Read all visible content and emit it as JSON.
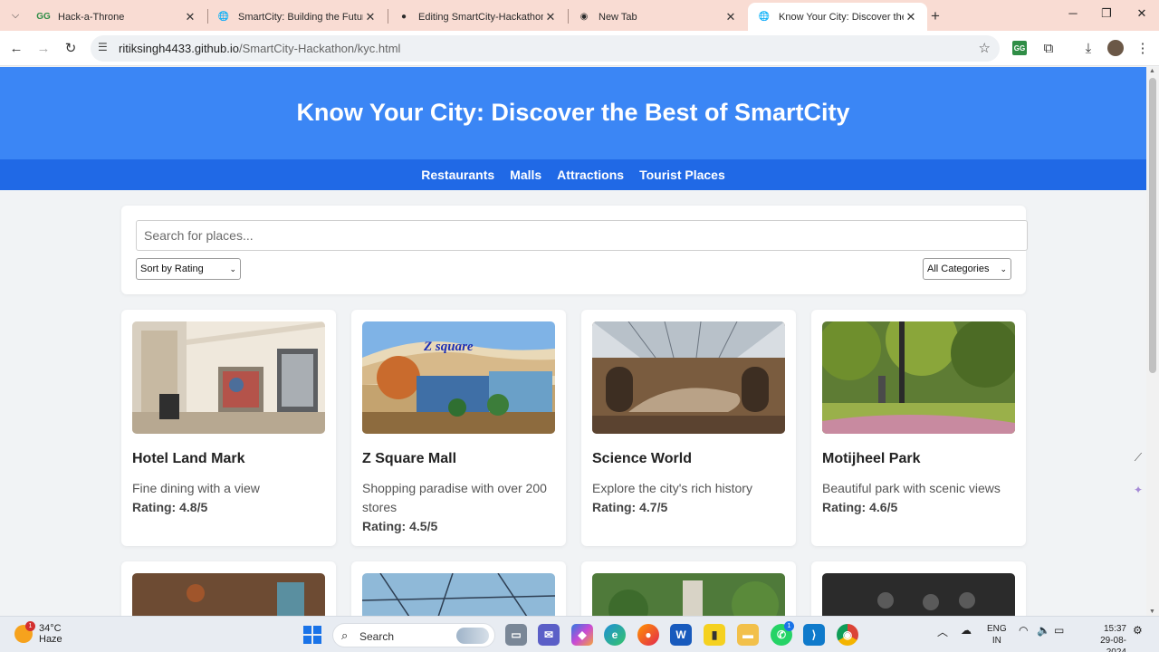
{
  "browser": {
    "tabs": [
      {
        "title": "Hack-a-Throne",
        "icon": "gfg-icon"
      },
      {
        "title": "SmartCity: Building the Future",
        "icon": "globe-icon"
      },
      {
        "title": "Editing SmartCity-Hackathon/R",
        "icon": "github-icon"
      },
      {
        "title": "New Tab",
        "icon": "chrome-icon"
      },
      {
        "title": "Know Your City: Discover the Be",
        "icon": "globe-icon"
      }
    ],
    "url_host": "ritiksingh4433.github.io",
    "url_path": "/SmartCity-Hackathon/kyc.html"
  },
  "page": {
    "title": "Know Your City: Discover the Best of SmartCity",
    "nav": [
      "Restaurants",
      "Malls",
      "Attractions",
      "Tourist Places"
    ],
    "search_placeholder": "Search for places...",
    "sort_selected": "Sort by Rating",
    "category_selected": "All Categories",
    "places": [
      {
        "name": "Hotel Land Mark",
        "description": "Fine dining with a view",
        "rating": "Rating: 4.8/5"
      },
      {
        "name": "Z Square Mall",
        "description": "Shopping paradise with over 200 stores",
        "rating": "Rating: 4.5/5",
        "sign": "Z square"
      },
      {
        "name": "Science World",
        "description": "Explore the city's rich history",
        "rating": "Rating: 4.7/5"
      },
      {
        "name": "Motijheel Park",
        "description": "Beautiful park with scenic views",
        "rating": "Rating: 4.6/5"
      }
    ]
  },
  "taskbar": {
    "weather_temp": "34°C",
    "weather_desc": "Haze",
    "weather_badge": "1",
    "search_label": "Search",
    "whatsapp_badge": "1",
    "lang_top": "ENG",
    "lang_bottom": "IN",
    "time": "15:37",
    "date": "29-08-2024"
  },
  "colors": {
    "header": "#3b86f5",
    "nav": "#2069e6",
    "tabbar": "#f9dcd3"
  }
}
